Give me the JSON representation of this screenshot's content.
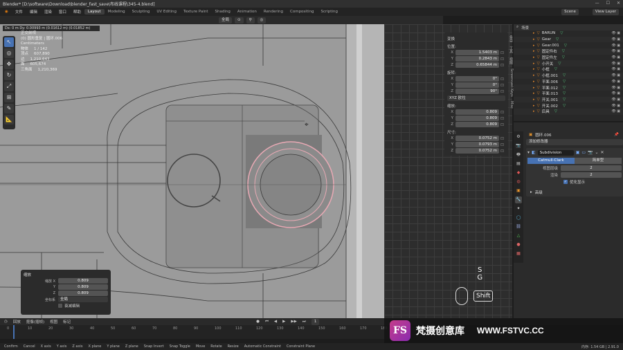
{
  "window": {
    "title": "Blender* [D:\\software\\Download\\blender_fast_save\\布线课程\\345-4.blend]"
  },
  "menu": [
    "文件",
    "编辑",
    "渲染",
    "窗口",
    "帮助"
  ],
  "workspaces": [
    "Layout",
    "Modeling",
    "Sculpting",
    "UV Editing",
    "Texture Paint",
    "Shading",
    "Animation",
    "Rendering",
    "Compositing",
    "Scripting"
  ],
  "header_right": {
    "scene": "Scene",
    "view_layer": "View Layer"
  },
  "viewport_header": {
    "orientation": "全局"
  },
  "coordbar": "Dx: 0 m  Dy: 0.00993 m (0.01612 m) (0.01852 m)",
  "stats": {
    "mode": "正交前视",
    "object": "(0) 圆形重复 | 圆环.006",
    "units": "Centimeters",
    "rows": [
      {
        "k": "物体",
        "v": "1 / 142"
      },
      {
        "k": "顶点",
        "v": "607,890"
      },
      {
        "k": "边",
        "v": "1,210,643"
      },
      {
        "k": "面",
        "v": "605,674"
      },
      {
        "k": "三角面",
        "v": "1,210,369"
      }
    ]
  },
  "npanel": {
    "title": "变换",
    "location_label": "位置:",
    "location": {
      "x": "1.5403 m",
      "y": "0.2843 m",
      "z": "0.65844 m"
    },
    "rotation_label": "旋转:",
    "rotation": {
      "x": "0°",
      "y": "0°",
      "z": "90°"
    },
    "rotation_mode": "XYZ 欧拉",
    "scale_label": "缩放:",
    "scale": {
      "x": "0.809",
      "y": "0.809",
      "z": "0.809"
    },
    "dimensions_label": "尺寸:",
    "dimensions": {
      "x": "0.0752 m",
      "y": "0.0793 m",
      "z": "0.0752 m"
    }
  },
  "ntabs": [
    "条目",
    "工具",
    "视图",
    "Screencast Keys",
    "Misc"
  ],
  "operator": {
    "title": "缩放",
    "rows": [
      {
        "k": "缩放 X",
        "v": "0.809"
      },
      {
        "k": "Y",
        "v": "0.809"
      },
      {
        "k": "Z",
        "v": "0.809"
      }
    ],
    "orientation_label": "坐标系",
    "orientation": "全局",
    "proportional": "衰减编辑"
  },
  "outliner": {
    "title": "场景",
    "items": [
      "BARUN",
      "Gear",
      "Gear.001",
      "固定件右",
      "固定件左",
      "小开关",
      "小框",
      "小框.001",
      "平面.006",
      "平面.012",
      "平面.013",
      "开关.001",
      "开关.002",
      "后具"
    ]
  },
  "properties": {
    "object_name": "圆环.006",
    "add_modifier": "添加修改器",
    "modifier_name": "Subdivision",
    "mode_a": "Catmull-Clark",
    "mode_b": "简单型",
    "levels_viewport_label": "视图层级",
    "levels_viewport": "2",
    "render_label": "渲染",
    "render": "2",
    "optimal": "优化显示",
    "advanced": "高级"
  },
  "timeline": {
    "playback": "回放",
    "keying": "抠像(插帧)",
    "view": "视图",
    "marker": "标记",
    "current_frame": "1",
    "ticks": [
      "0",
      "10",
      "20",
      "30",
      "40",
      "50",
      "60",
      "70",
      "80",
      "90",
      "100",
      "110",
      "120",
      "130",
      "140",
      "150",
      "160",
      "170",
      "180"
    ]
  },
  "statusbar": [
    "Confirm",
    "Cancel",
    "X axis",
    "Y axis",
    "Z axis",
    "X plane",
    "Y plane",
    "Z plane",
    "Snap Invert",
    "Snap Toggle",
    "Move",
    "Rotate",
    "Resize",
    "Automatic Constraint",
    "Constraint Plane"
  ],
  "status_right": "内存: 1.54 GB | 2.91.0",
  "keys": {
    "s": "S",
    "g": "G",
    "shift": "Shift"
  },
  "watermark": {
    "logo": "FS",
    "name": "梵摄创意库",
    "url": "WWW.FSTVC.CC"
  },
  "colors": {
    "accent": "#4772b3",
    "object_orange": "#d8822a",
    "mesh_green": "#55c27a"
  }
}
